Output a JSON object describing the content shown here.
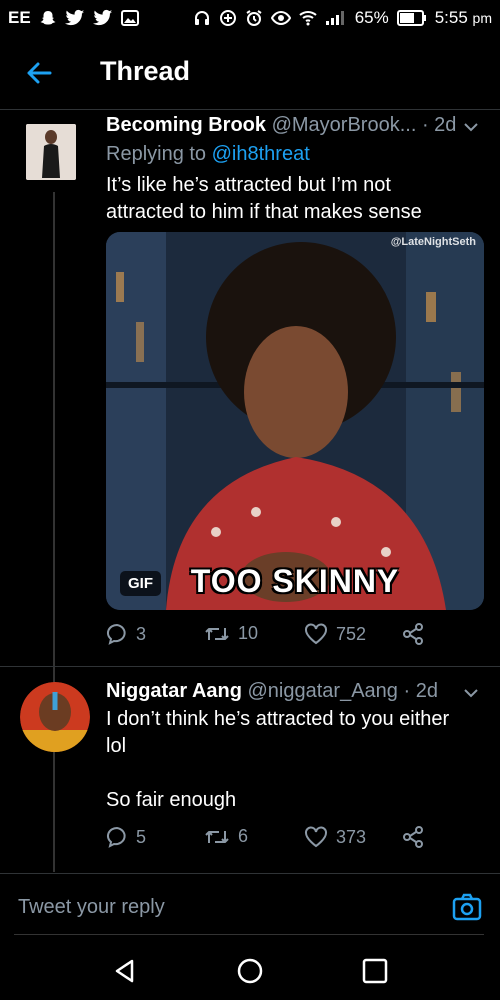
{
  "status_bar": {
    "carrier": "EE",
    "battery": "65%",
    "time": "5:55",
    "ampm": "pm"
  },
  "header": {
    "title": "Thread"
  },
  "tweets": [
    {
      "name": "Becoming Brook",
      "handle": "@MayorBrook...",
      "time": "· 2d",
      "replying_prefix": "Replying to ",
      "replying_to": "@ih8threat",
      "text_line1": "It’s like he’s attracted but I’m not",
      "text_line2": "attracted to him if that makes sense",
      "media": {
        "badge": "GIF",
        "caption": "TOO SKINNY",
        "watermark": "@LateNightSeth"
      },
      "replies": "3",
      "retweets": "10",
      "likes": "752"
    },
    {
      "name": "Niggatar Aang",
      "handle": "@niggatar_Aang",
      "time": "· 2d",
      "text_line1": "I don’t think he’s attracted to you either",
      "text_line2": "lol",
      "text_line3": "So fair enough",
      "replies": "5",
      "retweets": "6",
      "likes": "373"
    }
  ],
  "reply_bar": {
    "placeholder": "Tweet your reply"
  },
  "colors": {
    "background": "#000000",
    "accent": "#1da1f2",
    "muted": "#8b98a5"
  }
}
